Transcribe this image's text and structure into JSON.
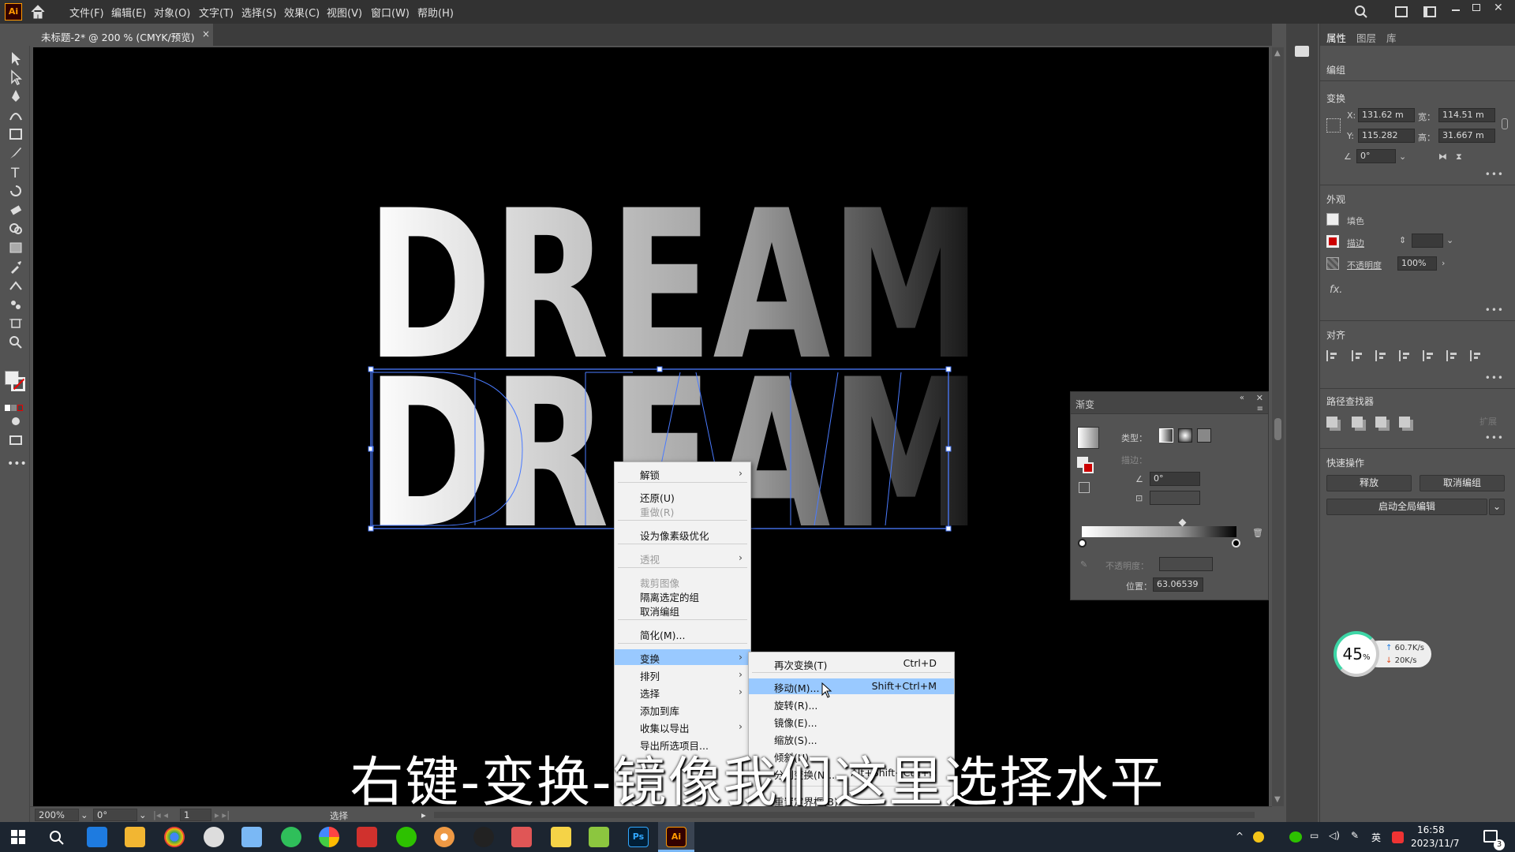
{
  "app": {
    "logo": "Ai"
  },
  "menu": [
    "文件(F)",
    "编辑(E)",
    "对象(O)",
    "文字(T)",
    "选择(S)",
    "效果(C)",
    "视图(V)",
    "窗口(W)",
    "帮助(H)"
  ],
  "document_tab": {
    "title": "未标题-2* @ 200 % (CMYK/预览)",
    "close": "×"
  },
  "artwork": {
    "word_top": "DREAM",
    "word_bottom": "DREAM"
  },
  "right_panel": {
    "tabs": [
      "属性",
      "图层",
      "库"
    ],
    "group_label": "编组",
    "transform": {
      "title": "变换",
      "x_label": "X:",
      "x": "131.62 m",
      "y_label": "Y:",
      "y": "115.282",
      "w_label": "宽：",
      "w": "114.51 m",
      "h_label": "高：",
      "h": "31.667 m",
      "angle": "0°"
    },
    "appearance": {
      "title": "外观",
      "fill": "填色",
      "stroke": "描边",
      "opacity_label": "不透明度",
      "opacity": "100%",
      "fx": "fx."
    },
    "align": {
      "title": "对齐"
    },
    "pathfinder": {
      "title": "路径查找器",
      "expand": "扩展"
    },
    "quick_actions": {
      "title": "快速操作",
      "release": "释放",
      "ungroup": "取消编组",
      "global_edit": "启动全局编辑"
    }
  },
  "gradient_panel": {
    "title": "渐变",
    "type_label": "类型：",
    "stroke_label": "描边：",
    "angle": "0°",
    "opacity_label": "不透明度：",
    "position_label": "位置：",
    "position": "63.06539",
    "colors": {
      "start": "#ffffff",
      "end": "#000000"
    }
  },
  "context_menu": {
    "items": [
      {
        "label": "解锁",
        "has_sub": true,
        "disabled": false
      },
      {
        "label": "还原(U)",
        "has_sub": false,
        "disabled": false
      },
      {
        "label": "重做(R)",
        "has_sub": false,
        "disabled": true
      },
      {
        "label": "设为像素级优化",
        "has_sub": false,
        "disabled": false
      },
      {
        "label": "透视",
        "has_sub": true,
        "disabled": true
      },
      {
        "label": "裁剪图像",
        "has_sub": false,
        "disabled": true
      },
      {
        "label": "隔离选定的组",
        "has_sub": false,
        "disabled": false
      },
      {
        "label": "取消编组",
        "has_sub": false,
        "disabled": false
      },
      {
        "label": "简化(M)...",
        "has_sub": false,
        "disabled": false
      },
      {
        "label": "变换",
        "has_sub": true,
        "disabled": false
      },
      {
        "label": "排列",
        "has_sub": true,
        "disabled": false
      },
      {
        "label": "选择",
        "has_sub": true,
        "disabled": false
      },
      {
        "label": "添加到库",
        "has_sub": false,
        "disabled": false
      },
      {
        "label": "收集以导出",
        "has_sub": true,
        "disabled": false
      },
      {
        "label": "导出所选项目...",
        "has_sub": false,
        "disabled": false
      }
    ]
  },
  "submenu": {
    "items": [
      {
        "label": "再次变换(T)",
        "shortcut": "Ctrl+D"
      },
      {
        "label": "移动(M)...",
        "shortcut": "Shift+Ctrl+M"
      },
      {
        "label": "旋转(R)...",
        "shortcut": ""
      },
      {
        "label": "镜像(E)...",
        "shortcut": ""
      },
      {
        "label": "缩放(S)...",
        "shortcut": ""
      },
      {
        "label": "倾斜(H)...",
        "shortcut": ""
      },
      {
        "label": "分别变换(N)...",
        "shortcut": "Alt+Shift+Ctrl+D"
      },
      {
        "label": "重置定界框(B)",
        "shortcut": ""
      }
    ]
  },
  "subtitle": "右键-变换-镜像我们这里选择水平",
  "statusbar": {
    "zoom": "200%",
    "rotation": "0°",
    "artboard": "1",
    "tool": "选择"
  },
  "network_widget": {
    "percent": "45",
    "percent_unit": "%",
    "up": "60.7K/s",
    "down": "20K/s"
  },
  "taskbar": {
    "time": "16:58",
    "date": "2023/11/7",
    "ime": "英",
    "notify_count": "3"
  }
}
